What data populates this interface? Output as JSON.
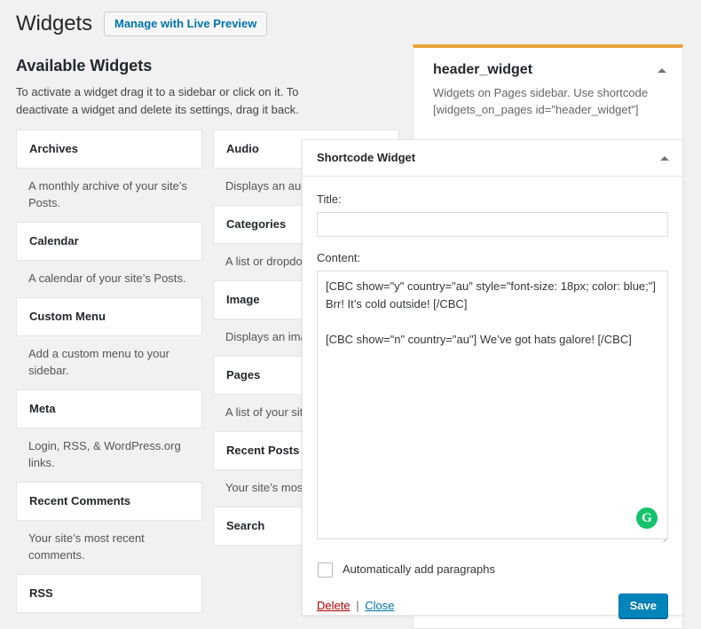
{
  "header": {
    "title": "Widgets",
    "live_preview_label": "Manage with Live Preview"
  },
  "available": {
    "section_title": "Available Widgets",
    "section_desc": "To activate a widget drag it to a sidebar or click on it. To deactivate a widget and delete its settings, drag it back.",
    "left_column": [
      {
        "name": "Archives",
        "desc": "A monthly archive of your site’s Posts."
      },
      {
        "name": "Calendar",
        "desc": "A calendar of your site’s Posts."
      },
      {
        "name": "Custom Menu",
        "desc": "Add a custom menu to your sidebar."
      },
      {
        "name": "Meta",
        "desc": "Login, RSS, & WordPress.org links."
      },
      {
        "name": "Recent Comments",
        "desc": "Your site’s most recent comments."
      },
      {
        "name": "RSS",
        "desc": ""
      }
    ],
    "right_column": [
      {
        "name": "Audio",
        "desc": "Displays an audio"
      },
      {
        "name": "Categories",
        "desc": "A list or dropdow categories."
      },
      {
        "name": "Image",
        "desc": "Displays an image"
      },
      {
        "name": "Pages",
        "desc": "A list of your site’"
      },
      {
        "name": "Recent Posts",
        "desc": "Your site’s most r"
      },
      {
        "name": "Search",
        "desc": ""
      }
    ]
  },
  "sidebar_panel": {
    "title": "header_widget",
    "desc": "Widgets on Pages sidebar. Use shortcode [widgets_on_pages id=\"header_widget\"]",
    "toggle_icon": "chevron-up-icon",
    "accent_color": "#eaa33d"
  },
  "modal": {
    "title": "Shortcode Widget",
    "toggle_icon": "chevron-up-icon",
    "title_field": {
      "label": "Title:",
      "value": "",
      "placeholder": ""
    },
    "content_field": {
      "label": "Content:",
      "value": "[CBC show=\"y\" country=\"au\" style=\"font-size: 18px; color: blue;\"] Brr! It’s cold outside! [/CBC]\n\n[CBC show=\"n\" country=\"au\"] We’ve got hats galore! [/CBC]",
      "placeholder": ""
    },
    "grammarly_icon": "grammarly-icon",
    "grammarly_glyph": "G",
    "grammarly_color": "#15c26b",
    "checkbox": {
      "label": "Automatically add paragraphs",
      "checked": false
    },
    "delete_label": "Delete",
    "separator": "|",
    "close_label": "Close",
    "save_label": "Save",
    "save_color": "#0085ba",
    "delete_color": "#a00"
  }
}
